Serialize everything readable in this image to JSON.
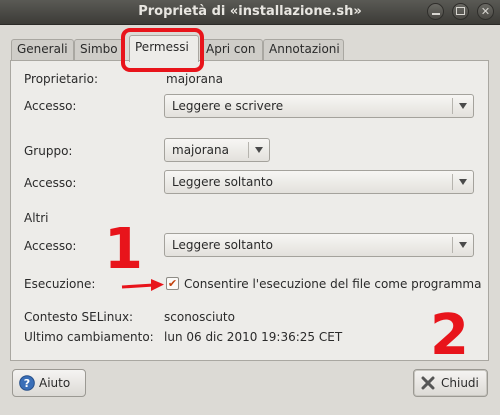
{
  "window": {
    "title": "Proprietà di «installazione.sh»"
  },
  "tabs": [
    {
      "label": "Generali"
    },
    {
      "label": "Simbo"
    },
    {
      "label": "Permessi"
    },
    {
      "label": "Apri con"
    },
    {
      "label": "Annotazioni"
    }
  ],
  "permissions": {
    "owner_label": "Proprietario:",
    "owner_value": "majorana",
    "owner_access_label": "Accesso:",
    "owner_access_value": "Leggere e scrivere",
    "group_label": "Gruppo:",
    "group_value": "majorana",
    "group_access_label": "Accesso:",
    "group_access_value": "Leggere soltanto",
    "others_label": "Altri",
    "others_access_label": "Accesso:",
    "others_access_value": "Leggere soltanto",
    "exec_label": "Esecuzione:",
    "exec_checkbox_label": "Consentire l'esecuzione del file come programma",
    "exec_checked_glyph": "✔",
    "selinux_label": "Contesto SELinux:",
    "selinux_value": "sconosciuto",
    "modified_label": "Ultimo cambiamento:",
    "modified_value": "lun 06 dic 2010 19:36:25 CET"
  },
  "annotations": {
    "num1": "1",
    "num2": "2",
    "color": "#e8141b"
  },
  "buttons": {
    "help_label": "Aiuto",
    "close_label": "Chiudi"
  },
  "colors": {
    "titlebar": "#3c3b37",
    "panel": "#edece9",
    "window_bg": "#dcdad5"
  }
}
